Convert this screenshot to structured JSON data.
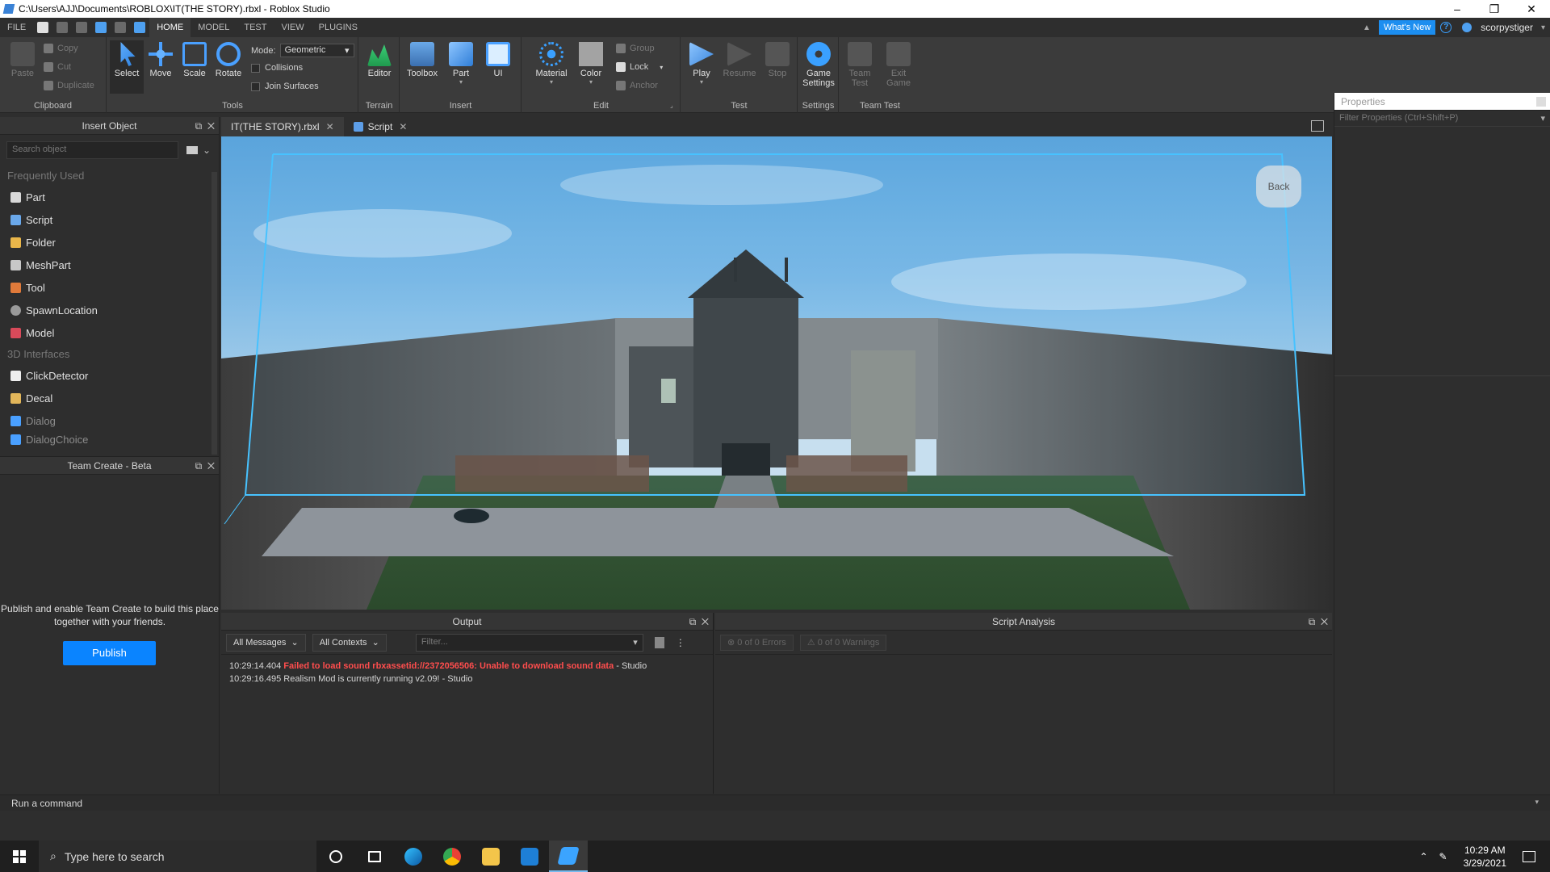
{
  "window": {
    "title": "C:\\Users\\AJJ\\Documents\\ROBLOX\\IT(THE STORY).rbxl - Roblox Studio",
    "minimize": "–",
    "maximize": "❐",
    "close": "✕"
  },
  "menu": {
    "tabs": [
      "FILE",
      "HOME",
      "MODEL",
      "TEST",
      "VIEW",
      "PLUGINS"
    ],
    "active": "HOME",
    "whats_new": "What's New",
    "help": "?",
    "user": "scorpystiger"
  },
  "ribbon": {
    "clipboard": {
      "paste": "Paste",
      "copy": "Copy",
      "cut": "Cut",
      "duplicate": "Duplicate",
      "label": "Clipboard"
    },
    "tools": {
      "select": "Select",
      "move": "Move",
      "scale": "Scale",
      "rotate": "Rotate",
      "mode_label": "Mode:",
      "mode_value": "Geometric",
      "collisions": "Collisions",
      "join_surfaces": "Join Surfaces",
      "label": "Tools"
    },
    "terrain": {
      "editor": "Editor",
      "label": "Terrain"
    },
    "insert": {
      "toolbox": "Toolbox",
      "part": "Part",
      "ui": "UI",
      "label": "Insert"
    },
    "edit": {
      "material": "Material",
      "color": "Color",
      "group": "Group",
      "lock": "Lock",
      "anchor": "Anchor",
      "label": "Edit"
    },
    "test": {
      "play": "Play",
      "resume": "Resume",
      "stop": "Stop",
      "label": "Test"
    },
    "settings": {
      "game_settings_1": "Game",
      "game_settings_2": "Settings",
      "label": "Settings"
    },
    "team_test": {
      "team_test_1": "Team",
      "team_test_2": "Test",
      "exit_game_1": "Exit",
      "exit_game_2": "Game",
      "label": "Team Test"
    }
  },
  "insert_object": {
    "title": "Insert Object",
    "search_placeholder": "Search object",
    "section_frequent": "Frequently Used",
    "items": [
      "Part",
      "Script",
      "Folder",
      "MeshPart",
      "Tool",
      "SpawnLocation",
      "Model"
    ],
    "section_3d": "3D Interfaces",
    "items_3d": [
      "ClickDetector",
      "Decal",
      "Dialog",
      "DialogChoice"
    ]
  },
  "team_create": {
    "title": "Team Create - Beta",
    "message_1": "Publish and enable Team Create to build this place",
    "message_2": "together with your friends.",
    "publish": "Publish"
  },
  "doc_tabs": [
    "IT(THE STORY).rbxl",
    "Script"
  ],
  "viewport": {
    "back": "Back"
  },
  "output": {
    "title": "Output",
    "filter_messages": "All Messages",
    "filter_contexts": "All Contexts",
    "filter_placeholder": "Filter...",
    "logs": [
      {
        "time": "10:29:14.404",
        "text": "Failed to load sound rbxassetid://2372056506: Unable to download sound data",
        "source": "- Studio",
        "type": "error"
      },
      {
        "time": "10:29:16.495",
        "text": "Realism Mod is currently running v2.09!",
        "source": "- Studio",
        "type": "info"
      }
    ]
  },
  "script_analysis": {
    "title": "Script Analysis",
    "errors": "0 of 0 Errors",
    "warnings": "0 of 0 Warnings"
  },
  "properties": {
    "title": "Properties",
    "filter_placeholder": "Filter Properties (Ctrl+Shift+P)"
  },
  "command_bar": {
    "placeholder": "Run a command"
  },
  "taskbar": {
    "search_placeholder": "Type here to search",
    "time": "10:29 AM",
    "date": "3/29/2021"
  },
  "colors": {
    "accent": "#0a84ff",
    "error": "#ff4d4d",
    "background": "#2e2e2e"
  }
}
